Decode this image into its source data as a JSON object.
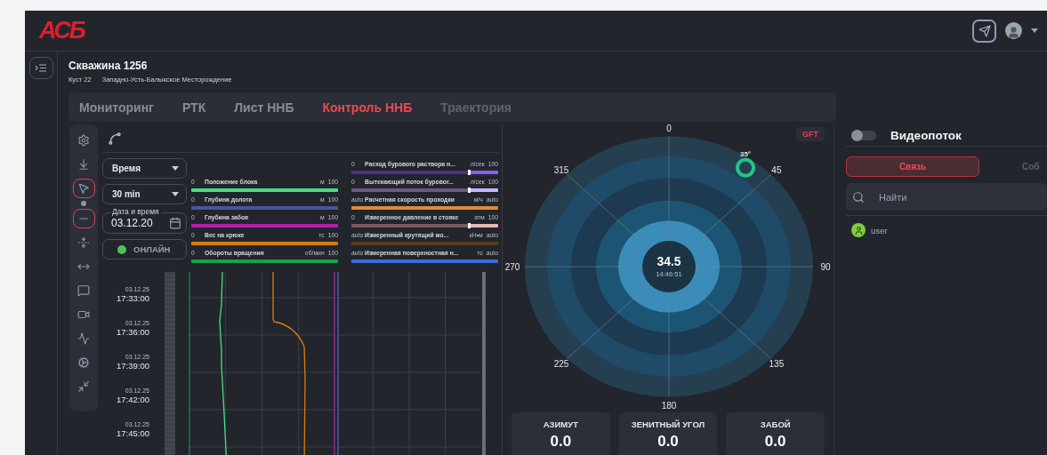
{
  "header": {
    "logo": "АСБ"
  },
  "well": {
    "title": "Скважина 1256",
    "pad": "Куст 22",
    "field": "Западно-Усть-Балыкское Месторождение"
  },
  "tabs": [
    {
      "label": "Мониторинг",
      "selected": false,
      "disabled": false
    },
    {
      "label": "РТК",
      "selected": false,
      "disabled": false
    },
    {
      "label": "Лист ННБ",
      "selected": false,
      "disabled": false
    },
    {
      "label": "Контроль ННБ",
      "selected": true,
      "disabled": false
    },
    {
      "label": "Траектория",
      "selected": false,
      "disabled": true
    }
  ],
  "tools": [
    {
      "selected": false
    },
    {
      "selected": false
    },
    {
      "selected": true
    },
    {
      "selected": true
    },
    {
      "selected": false
    },
    {
      "selected": false
    },
    {
      "selected": false
    },
    {
      "selected": false
    },
    {
      "selected": false
    },
    {
      "selected": false
    },
    {
      "selected": false
    }
  ],
  "controls": {
    "axis_select": "Время",
    "range_select": "30 min",
    "date_label": "Дата и время",
    "date_value": "03.12.20",
    "online_button": "ОНЛАЙН"
  },
  "legend_left": [
    {
      "min": "0",
      "name": "Положение блока",
      "unit": "м",
      "max": "100",
      "color": "#4ade80"
    },
    {
      "min": "0",
      "name": "Глубина долота",
      "unit": "м",
      "max": "100",
      "color": "#4b5596"
    },
    {
      "min": "0",
      "name": "Глубина забоя",
      "unit": "м",
      "max": "100",
      "color": "#b51fb0"
    },
    {
      "min": "0",
      "name": "Вес на крюке",
      "unit": "тс",
      "max": "100",
      "color": "#d97b0f"
    },
    {
      "min": "0",
      "name": "Обороты вращения",
      "unit": "об/мин",
      "max": "100",
      "color": "#16a34a"
    }
  ],
  "legend_right": [
    {
      "min": "0",
      "name": "Расход бурового раствора н...",
      "unit": "л/сек",
      "max": "100",
      "color": "#8b5cf6",
      "level": 0.8
    },
    {
      "min": "0",
      "name": "Вытекающий поток буровог...",
      "unit": "л/сек",
      "max": "100",
      "color": "#c4b5fd",
      "level": 0.8
    },
    {
      "min": "auto",
      "name": "Расчетная скорость проходки",
      "unit": "м/ч",
      "max": "auto",
      "color": "#e08a3c"
    },
    {
      "min": "0",
      "name": "Измеренное давление в стояке",
      "unit": "атм",
      "max": "100",
      "color": "#e6b8b0",
      "level": 0.8
    },
    {
      "min": "auto",
      "name": "Измеренный крутящий мо...",
      "unit": "кН•м",
      "max": "auto",
      "color": "#5a3f1e"
    },
    {
      "min": "auto",
      "name": "Измеренная поверхностная н...",
      "unit": "тс",
      "max": "auto",
      "color": "#3b6fd8"
    }
  ],
  "time_axis": [
    {
      "date": "03.12.25",
      "time": "17:33:00"
    },
    {
      "date": "03.12.25",
      "time": "17:36:00"
    },
    {
      "date": "03.12.25",
      "time": "17:39:00"
    },
    {
      "date": "03.12.25",
      "time": "17:42:00"
    },
    {
      "date": "03.12.25",
      "time": "17:45:00"
    }
  ],
  "compass": {
    "badge": "GFT",
    "labels": [
      "0",
      "45",
      "90",
      "135",
      "180",
      "225",
      "270",
      "315"
    ],
    "center_value": "34.5",
    "center_time": "14:46:51",
    "marker_label": "35°"
  },
  "cards": [
    {
      "title": "АЗИМУТ",
      "value": "0.0"
    },
    {
      "title": "ЗЕНИТНЫЙ УГОЛ",
      "value": "0.0"
    },
    {
      "title": "ЗАБОЙ",
      "value": "0.0"
    }
  ],
  "side": {
    "video_toggle": {
      "label": "Видеопоток",
      "on": false
    },
    "tabs": [
      {
        "label": "Связь",
        "selected": true
      },
      {
        "label": "Соб",
        "selected": false
      }
    ],
    "search": {
      "placeholder": "Найти"
    },
    "users": [
      {
        "name": "user"
      }
    ]
  }
}
